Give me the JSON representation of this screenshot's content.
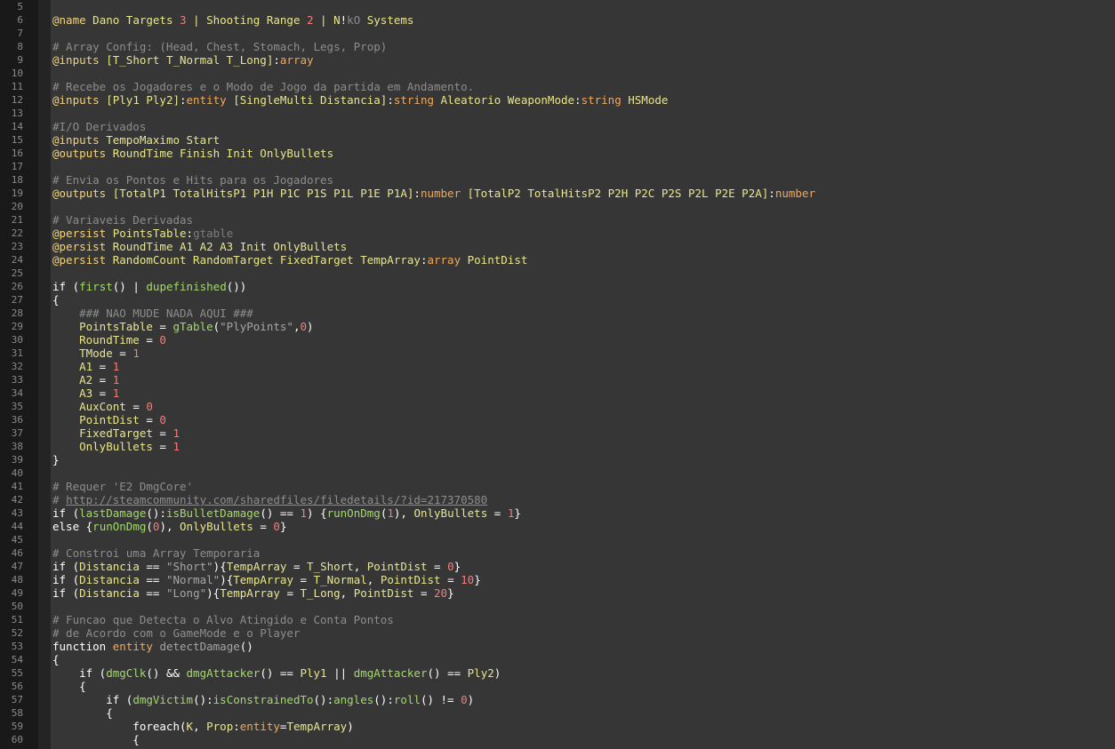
{
  "colors": {
    "background": "#363636",
    "gutter": "#191919",
    "directive": "#f3d37a",
    "comment": "#8d8d8d",
    "number": "#f77b7b",
    "type": "#f0a95e",
    "function": "#a3d96a",
    "variable": "#e9e68c"
  },
  "line_numbers": [
    "5",
    "6",
    "7",
    "8",
    "9",
    "10",
    "11",
    "12",
    "13",
    "14",
    "15",
    "16",
    "17",
    "18",
    "19",
    "20",
    "21",
    "22",
    "23",
    "24",
    "25",
    "26",
    "27",
    "28",
    "29",
    "30",
    "31",
    "32",
    "33",
    "34",
    "35",
    "36",
    "37",
    "38",
    "39",
    "40",
    "41",
    "42",
    "43",
    "44",
    "45",
    "46",
    "47",
    "48",
    "49",
    "50",
    "51",
    "52",
    "53",
    "54",
    "55",
    "56",
    "57",
    "58",
    "59",
    "60"
  ],
  "lines": [
    [],
    [
      [
        "dir",
        "@name"
      ],
      [
        "var",
        " Dano Targets "
      ],
      [
        "num",
        "3"
      ],
      [
        "var",
        " | Shooting Range "
      ],
      [
        "num",
        "2"
      ],
      [
        "var",
        " | N"
      ],
      [
        "plain",
        "!"
      ],
      [
        "dimk",
        "kO"
      ],
      [
        "var",
        " Systems"
      ]
    ],
    [],
    [
      [
        "com",
        "# Array Config: (Head, Chest, Stomach, Legs, Prop)"
      ]
    ],
    [
      [
        "dir",
        "@inputs"
      ],
      [
        "var",
        " [T_Short T_Normal T_Long]"
      ],
      [
        "plain",
        ":"
      ],
      [
        "type",
        "array"
      ]
    ],
    [],
    [
      [
        "com",
        "# Recebe os Jogadores e o Modo de Jogo da partida em Andamento."
      ]
    ],
    [
      [
        "dir",
        "@inputs"
      ],
      [
        "var",
        " [Ply1 Ply2]"
      ],
      [
        "plain",
        ":"
      ],
      [
        "type",
        "entity"
      ],
      [
        "var",
        " [SingleMulti Distancia]"
      ],
      [
        "plain",
        ":"
      ],
      [
        "type",
        "string"
      ],
      [
        "var",
        " Aleatorio WeaponMode"
      ],
      [
        "plain",
        ":"
      ],
      [
        "type",
        "string"
      ],
      [
        "var",
        " HSMode"
      ]
    ],
    [],
    [
      [
        "com",
        "#I/O Derivados"
      ]
    ],
    [
      [
        "dir",
        "@inputs"
      ],
      [
        "var",
        " TempoMaximo Start"
      ]
    ],
    [
      [
        "dir",
        "@outputs"
      ],
      [
        "var",
        " RoundTime Finish Init OnlyBullets"
      ]
    ],
    [],
    [
      [
        "com",
        "# Envia os Pontos e Hits para os Jogadores"
      ]
    ],
    [
      [
        "dir",
        "@outputs"
      ],
      [
        "var",
        " [TotalP1 TotalHitsP1 P1H P1C P1S P1L P1E P1A]"
      ],
      [
        "plain",
        ":"
      ],
      [
        "type",
        "number"
      ],
      [
        "var",
        " [TotalP2 TotalHitsP2 P2H P2C P2S P2L P2E P2A]"
      ],
      [
        "plain",
        ":"
      ],
      [
        "type",
        "number"
      ]
    ],
    [],
    [
      [
        "com",
        "# Variaveis Derivadas"
      ]
    ],
    [
      [
        "dir",
        "@persist"
      ],
      [
        "var",
        " PointsTable"
      ],
      [
        "plain",
        ":"
      ],
      [
        "gt",
        "gtable"
      ]
    ],
    [
      [
        "dir",
        "@persist"
      ],
      [
        "var",
        " RoundTime A1 A2 A3 Init OnlyBullets"
      ]
    ],
    [
      [
        "dir",
        "@persist"
      ],
      [
        "var",
        " RandomCount RandomTarget FixedTarget TempArray"
      ],
      [
        "plain",
        ":"
      ],
      [
        "type",
        "array"
      ],
      [
        "var",
        " PointDist"
      ]
    ],
    [],
    [
      [
        "kw",
        "if"
      ],
      [
        "plain",
        " ("
      ],
      [
        "fn",
        "first"
      ],
      [
        "plain",
        "() | "
      ],
      [
        "fn",
        "dupefinished"
      ],
      [
        "plain",
        "())"
      ]
    ],
    [
      [
        "plain",
        "{"
      ]
    ],
    [
      [
        "com",
        "    ### NAO MUDE NADA AQUI ###"
      ]
    ],
    [
      [
        "var",
        "    PointsTable"
      ],
      [
        "plain",
        " = "
      ],
      [
        "fn",
        "gTable"
      ],
      [
        "plain",
        "("
      ],
      [
        "str",
        "\"PlyPoints\""
      ],
      [
        "plain",
        ","
      ],
      [
        "num",
        "0"
      ],
      [
        "plain",
        ")"
      ]
    ],
    [
      [
        "var",
        "    RoundTime"
      ],
      [
        "plain",
        " = "
      ],
      [
        "num",
        "0"
      ]
    ],
    [
      [
        "var",
        "    TMode"
      ],
      [
        "plain",
        " = "
      ],
      [
        "num",
        "1"
      ]
    ],
    [
      [
        "var",
        "    A1"
      ],
      [
        "plain",
        " = "
      ],
      [
        "num",
        "1"
      ]
    ],
    [
      [
        "var",
        "    A2"
      ],
      [
        "plain",
        " = "
      ],
      [
        "num",
        "1"
      ]
    ],
    [
      [
        "var",
        "    A3"
      ],
      [
        "plain",
        " = "
      ],
      [
        "num",
        "1"
      ]
    ],
    [
      [
        "var",
        "    AuxCont"
      ],
      [
        "plain",
        " = "
      ],
      [
        "num",
        "0"
      ]
    ],
    [
      [
        "var",
        "    PointDist"
      ],
      [
        "plain",
        " = "
      ],
      [
        "num",
        "0"
      ]
    ],
    [
      [
        "var",
        "    FixedTarget"
      ],
      [
        "plain",
        " = "
      ],
      [
        "num",
        "1"
      ]
    ],
    [
      [
        "var",
        "    OnlyBullets"
      ],
      [
        "plain",
        " = "
      ],
      [
        "num",
        "1"
      ]
    ],
    [
      [
        "plain",
        "}"
      ]
    ],
    [],
    [
      [
        "com",
        "# Requer 'E2 DmgCore'"
      ]
    ],
    [
      [
        "com",
        "# "
      ],
      [
        "link",
        "http://steamcommunity.com/sharedfiles/filedetails/?id=217370580"
      ]
    ],
    [
      [
        "kw",
        "if"
      ],
      [
        "plain",
        " ("
      ],
      [
        "fn",
        "lastDamage"
      ],
      [
        "plain",
        "():"
      ],
      [
        "fn",
        "isBulletDamage"
      ],
      [
        "plain",
        "() == "
      ],
      [
        "num",
        "1"
      ],
      [
        "plain",
        ") {"
      ],
      [
        "fn",
        "runOnDmg"
      ],
      [
        "plain",
        "("
      ],
      [
        "num",
        "1"
      ],
      [
        "plain",
        "), "
      ],
      [
        "var",
        "OnlyBullets"
      ],
      [
        "plain",
        " = "
      ],
      [
        "num",
        "1"
      ],
      [
        "plain",
        "}"
      ]
    ],
    [
      [
        "kw",
        "else"
      ],
      [
        "plain",
        " {"
      ],
      [
        "fn",
        "runOnDmg"
      ],
      [
        "plain",
        "("
      ],
      [
        "num",
        "0"
      ],
      [
        "plain",
        "), "
      ],
      [
        "var",
        "OnlyBullets"
      ],
      [
        "plain",
        " = "
      ],
      [
        "num",
        "0"
      ],
      [
        "plain",
        "}"
      ]
    ],
    [],
    [
      [
        "com",
        "# Constroi uma Array Temporaria"
      ]
    ],
    [
      [
        "kw",
        "if"
      ],
      [
        "plain",
        " ("
      ],
      [
        "var",
        "Distancia"
      ],
      [
        "plain",
        " == "
      ],
      [
        "str",
        "\"Short\""
      ],
      [
        "plain",
        ")"
      ],
      [
        "plain",
        "{"
      ],
      [
        "var",
        "TempArray"
      ],
      [
        "plain",
        " = "
      ],
      [
        "var",
        "T_Short"
      ],
      [
        "plain",
        ", "
      ],
      [
        "var",
        "PointDist"
      ],
      [
        "plain",
        " = "
      ],
      [
        "num",
        "0"
      ],
      [
        "plain",
        "}"
      ]
    ],
    [
      [
        "kw",
        "if"
      ],
      [
        "plain",
        " ("
      ],
      [
        "var",
        "Distancia"
      ],
      [
        "plain",
        " == "
      ],
      [
        "str",
        "\"Normal\""
      ],
      [
        "plain",
        ")"
      ],
      [
        "plain",
        "{"
      ],
      [
        "var",
        "TempArray"
      ],
      [
        "plain",
        " = "
      ],
      [
        "var",
        "T_Normal"
      ],
      [
        "plain",
        ", "
      ],
      [
        "var",
        "PointDist"
      ],
      [
        "plain",
        " = "
      ],
      [
        "num",
        "10"
      ],
      [
        "plain",
        "}"
      ]
    ],
    [
      [
        "kw",
        "if"
      ],
      [
        "plain",
        " ("
      ],
      [
        "var",
        "Distancia"
      ],
      [
        "plain",
        " == "
      ],
      [
        "str",
        "\"Long\""
      ],
      [
        "plain",
        ")"
      ],
      [
        "plain",
        "{"
      ],
      [
        "var",
        "TempArray"
      ],
      [
        "plain",
        " = "
      ],
      [
        "var",
        "T_Long"
      ],
      [
        "plain",
        ", "
      ],
      [
        "var",
        "PointDist"
      ],
      [
        "plain",
        " = "
      ],
      [
        "num",
        "20"
      ],
      [
        "plain",
        "}"
      ]
    ],
    [],
    [
      [
        "com",
        "# Funcao que Detecta o Alvo Atingido e Conta Pontos"
      ]
    ],
    [
      [
        "com",
        "# de Acordo com o GameMode e o Player"
      ]
    ],
    [
      [
        "kw",
        "function"
      ],
      [
        "plain",
        " "
      ],
      [
        "type",
        "entity"
      ],
      [
        "plain",
        " "
      ],
      [
        "fnd",
        "detectDamage"
      ],
      [
        "plain",
        "()"
      ]
    ],
    [
      [
        "plain",
        "{"
      ]
    ],
    [
      [
        "kw",
        "    if"
      ],
      [
        "plain",
        " ("
      ],
      [
        "fn",
        "dmgClk"
      ],
      [
        "plain",
        "() && "
      ],
      [
        "fn",
        "dmgAttacker"
      ],
      [
        "plain",
        "() == "
      ],
      [
        "var",
        "Ply1"
      ],
      [
        "plain",
        " || "
      ],
      [
        "fn",
        "dmgAttacker"
      ],
      [
        "plain",
        "() == "
      ],
      [
        "var",
        "Ply2"
      ],
      [
        "plain",
        ")"
      ]
    ],
    [
      [
        "plain",
        "    {"
      ]
    ],
    [
      [
        "kw",
        "        if"
      ],
      [
        "plain",
        " ("
      ],
      [
        "fn",
        "dmgVictim"
      ],
      [
        "plain",
        "():"
      ],
      [
        "fn",
        "isConstrainedTo"
      ],
      [
        "plain",
        "():"
      ],
      [
        "fn",
        "angles"
      ],
      [
        "plain",
        "():"
      ],
      [
        "fn",
        "roll"
      ],
      [
        "plain",
        "() != "
      ],
      [
        "num",
        "0"
      ],
      [
        "plain",
        ")"
      ]
    ],
    [
      [
        "plain",
        "        {"
      ]
    ],
    [
      [
        "kw",
        "            foreach"
      ],
      [
        "plain",
        "("
      ],
      [
        "var",
        "K"
      ],
      [
        "plain",
        ", "
      ],
      [
        "var",
        "Prop"
      ],
      [
        "plain",
        ":"
      ],
      [
        "type",
        "entity"
      ],
      [
        "plain",
        "="
      ],
      [
        "var",
        "TempArray"
      ],
      [
        "plain",
        ")"
      ]
    ],
    [
      [
        "plain",
        "            {"
      ]
    ]
  ]
}
